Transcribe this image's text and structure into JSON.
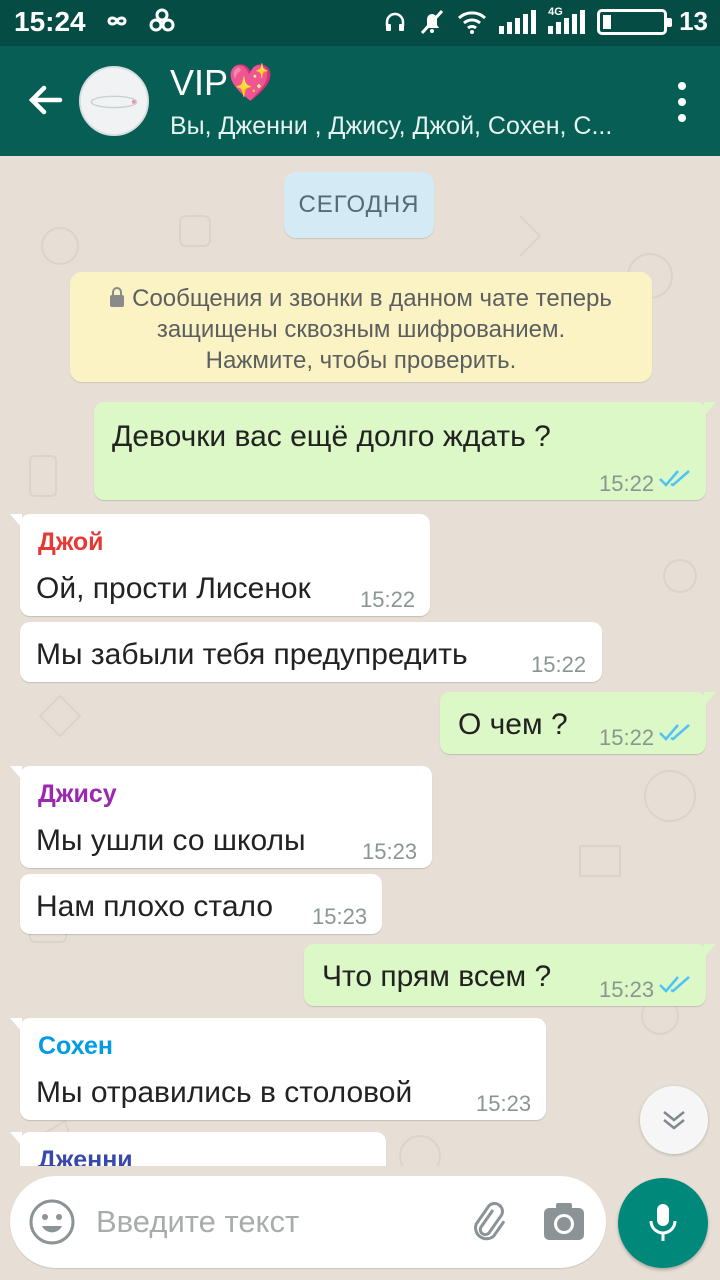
{
  "status_bar": {
    "time": "15:24",
    "left_icons": [
      "infinity-icon",
      "link-icon"
    ],
    "right_icons": [
      "headset-icon",
      "bell-off-icon",
      "wifi-icon",
      "signal-icon",
      "4g-signal-icon"
    ],
    "network_label": "4G",
    "battery_level": 0.13,
    "battery_text": "13"
  },
  "header": {
    "title": "VIP💖",
    "subtitle": "Вы, Дженни , Джису, Джой, Сохен, С..."
  },
  "chat": {
    "date_chip": "СЕГОДНЯ",
    "encryption_notice": {
      "line1": "Сообщения и звонки в данном чате теперь",
      "line2": "защищены сквозным шифрованием.",
      "line3": "Нажмите, чтобы проверить."
    },
    "messages": [
      {
        "dir": "out",
        "text": "Девочки вас ещё долго ждать ?",
        "time": "15:22",
        "status": "read"
      },
      {
        "dir": "in",
        "sender": "Джой",
        "sender_color": "#e53935",
        "text": "Ой, прости Лисенок",
        "time": "15:22"
      },
      {
        "dir": "in",
        "text": "Мы забыли тебя предупредить",
        "time": "15:22"
      },
      {
        "dir": "out",
        "text": "О чем ?",
        "time": "15:22",
        "status": "read"
      },
      {
        "dir": "in",
        "sender": "Джису",
        "sender_color": "#9c27b0",
        "text": "Мы ушли со школы",
        "time": "15:23"
      },
      {
        "dir": "in",
        "text": "Нам плохо стало",
        "time": "15:23"
      },
      {
        "dir": "out",
        "text": "Что прям всем ?",
        "time": "15:23",
        "status": "read"
      },
      {
        "dir": "in",
        "sender": "Сохен",
        "sender_color": "#039be5",
        "text": "Мы отравились в столовой",
        "time": "15:23"
      },
      {
        "dir": "in",
        "sender": "Дженни",
        "sender_color": "#3949ab",
        "text": "",
        "time": ""
      }
    ]
  },
  "input": {
    "placeholder": "Введите текст",
    "value": ""
  },
  "colors": {
    "toolbar": "#075e54",
    "status_bar": "#054d44",
    "outgoing_bubble": "#dcf8c6",
    "incoming_bubble": "#ffffff",
    "read_ticks": "#4fc3f7",
    "fab": "#00897b"
  }
}
